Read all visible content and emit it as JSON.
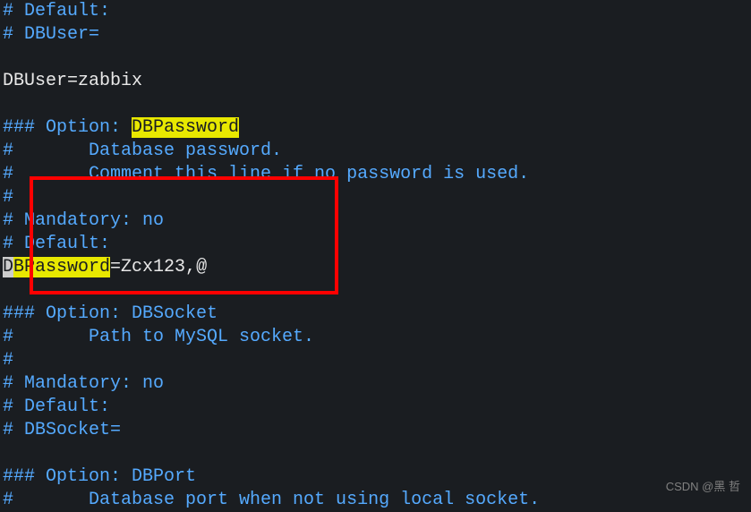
{
  "lines": {
    "l1": "# Default:",
    "l2": "# DBUser=",
    "l3": "",
    "l4": "DBUser=zabbix",
    "l5": "",
    "l6a": "### Option: ",
    "l6b": "DBPassword",
    "l7": "#       Database password.",
    "l8": "#       Comment this line if no password is used.",
    "l9": "#",
    "l10": "# Mandatory: no",
    "l11": "# Default:",
    "l12a": "D",
    "l12b": "BPassword",
    "l12c": "=Zcx123,@",
    "l13": "",
    "l14": "### Option: DBSocket",
    "l15": "#       Path to MySQL socket.",
    "l16": "#",
    "l17": "# Mandatory: no",
    "l18": "# Default:",
    "l19": "# DBSocket=",
    "l20": "",
    "l21": "### Option: DBPort",
    "l22": "#       Database port when not using local socket."
  },
  "watermark": "CSDN @黑 哲"
}
